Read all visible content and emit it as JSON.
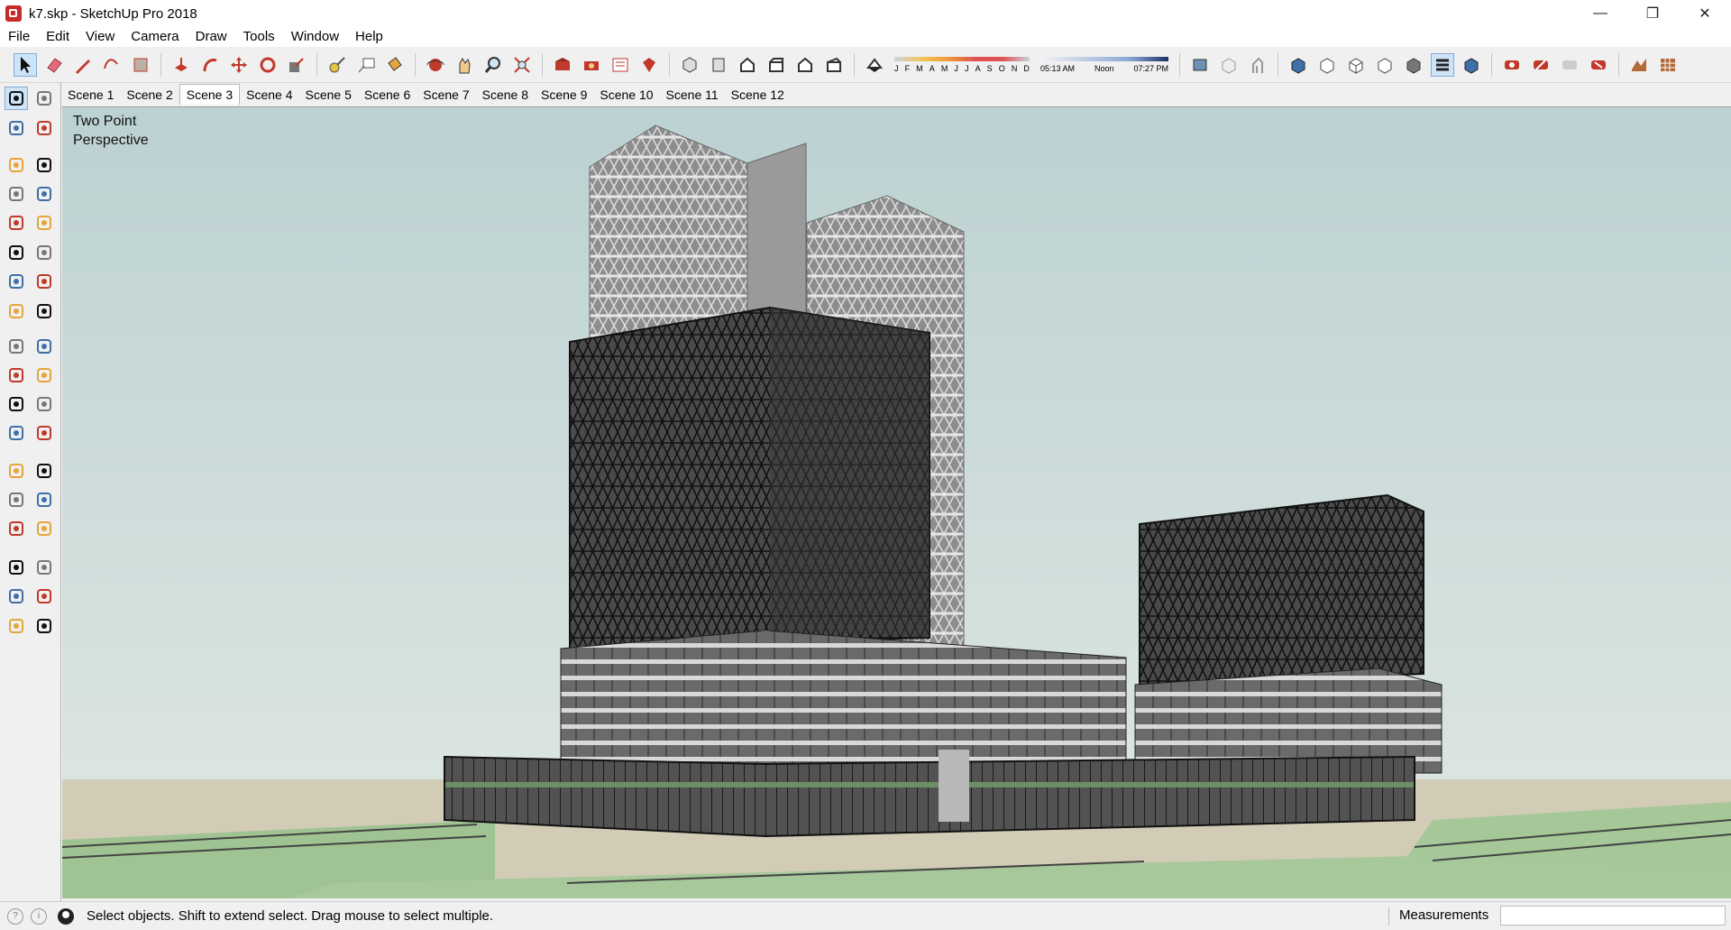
{
  "window": {
    "title": "k7.skp - SketchUp Pro 2018",
    "minimize_glyph": "—",
    "restore_glyph": "❐",
    "close_glyph": "✕"
  },
  "menu": [
    "File",
    "Edit",
    "View",
    "Camera",
    "Draw",
    "Tools",
    "Window",
    "Help"
  ],
  "shadow": {
    "months": [
      "J",
      "F",
      "M",
      "A",
      "M",
      "J",
      "J",
      "A",
      "S",
      "O",
      "N",
      "D"
    ],
    "time_start": "05:13 AM",
    "time_mid": "Noon",
    "time_end": "07:27 PM"
  },
  "scenes": {
    "tabs": [
      "Scene 1",
      "Scene 2",
      "Scene 3",
      "Scene 4",
      "Scene 5",
      "Scene 6",
      "Scene 7",
      "Scene 8",
      "Scene 9",
      "Scene 10",
      "Scene 11",
      "Scene 12"
    ],
    "active": "Scene 3"
  },
  "viewport": {
    "camera_label_line1": "Two Point",
    "camera_label_line2": "Perspective",
    "sky_top": "#bcd1d2",
    "sky_bottom": "#dfe7e3",
    "ground_color": "#cfc9b4",
    "grass_color": "#a7c79a"
  },
  "status": {
    "hint": "Select objects. Shift to extend select. Drag mouse to select multiple.",
    "measurements_label": "Measurements",
    "measurements_value": ""
  },
  "icons": {
    "toolbar": [
      "select-arrow",
      "eraser",
      "pencil-line",
      "freehand-shapes",
      "rectangle",
      "push-pull",
      "follow-me",
      "move",
      "rotate",
      "scale",
      "tape-measure",
      "text-label",
      "paint-bucket",
      "orbit",
      "pan",
      "zoom",
      "zoom-extents",
      "warehouse-3d",
      "extension-warehouse",
      "layout-send",
      "ruby-console",
      "iso-view",
      "top-view",
      "front-view",
      "right-view",
      "back-view",
      "left-view",
      "shadows-toggle",
      "x-ray",
      "back-edges",
      "wireframe",
      "hidden-line",
      "shaded",
      "shaded-textures",
      "monochrome",
      "photo-match",
      "section-plane",
      "display-section",
      "geo-location",
      "sandbox-tools"
    ],
    "lefttools": [
      "select-arrow",
      "component",
      "paint-bucket",
      "eraser",
      "pencil-line",
      "freehand",
      "rectangle",
      "rotated-rectangle",
      "circle",
      "polygon",
      "arc",
      "pie",
      "two-point-arc",
      "three-point-arc",
      "move",
      "push-pull",
      "rotate",
      "follow-me",
      "scale",
      "offset",
      "tape-measure",
      "dimension",
      "protractor",
      "text-label",
      "axes",
      "3d-text",
      "orbit",
      "pan",
      "zoom",
      "zoom-window",
      "zoom-extents",
      "previous-view",
      "position-camera",
      "look-around",
      "walk",
      "section-plane"
    ]
  }
}
